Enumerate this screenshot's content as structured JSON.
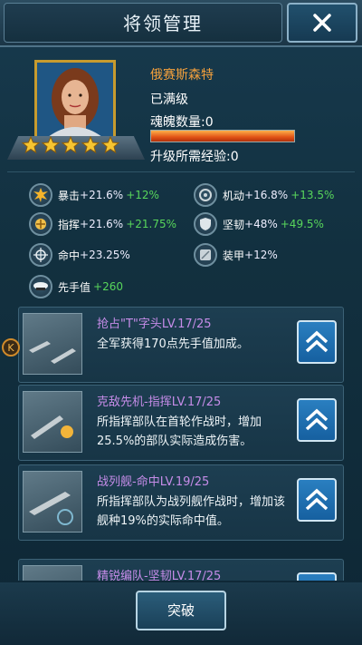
{
  "header": {
    "title": "将领管理",
    "close_icon": "close-icon"
  },
  "commander": {
    "name": "俄赛斯森特",
    "max_level_text": "已满级",
    "soul_label": "魂魄数量:0",
    "exp_label": "升级所需经验:0",
    "exp_progress": 1.0,
    "stars": 5
  },
  "stats": [
    {
      "icon": "explosion-icon",
      "label": "暴击",
      "value": "+21.6%",
      "bonus": "+12%"
    },
    {
      "icon": "gear-wheel-icon",
      "label": "机动",
      "value": "+16.8%",
      "bonus": "+13.5%"
    },
    {
      "icon": "command-burst-icon",
      "label": "指挥",
      "value": "+21.6%",
      "bonus": "+21.75%"
    },
    {
      "icon": "shield-icon",
      "label": "坚韧",
      "value": "+48%",
      "bonus": "+49.5%"
    },
    {
      "icon": "crosshair-icon",
      "label": "命中",
      "value": "+23.25%",
      "bonus": ""
    },
    {
      "icon": "armor-plate-icon",
      "label": "装甲",
      "value": "+12%",
      "bonus": ""
    },
    {
      "icon": "officer-cap-icon",
      "label": "先手值",
      "value": "+260",
      "bonus": ""
    }
  ],
  "skills": [
    {
      "title": "抢占\"T\"字头LV.17/25",
      "desc": "全军获得170点先手值加成。"
    },
    {
      "title": "克敌先机-指挥LV.17/25",
      "desc": "所指挥部队在首轮作战时，增加25.5%的部队实际造成伤害。"
    },
    {
      "title": "战列舰-命中LV.19/25",
      "desc": "所指挥部队为战列舰作战时，增加该舰种19%的实际命中值。"
    },
    {
      "title": "精锐编队-坚韧LV.17/25",
      "desc": ""
    }
  ],
  "side_badge": "K",
  "footer": {
    "break_label": "突破"
  },
  "colors": {
    "name": "#f4a03c",
    "bonus": "#58d65b",
    "skill_title": "#c58ce8",
    "gold": "#c79b2e"
  }
}
